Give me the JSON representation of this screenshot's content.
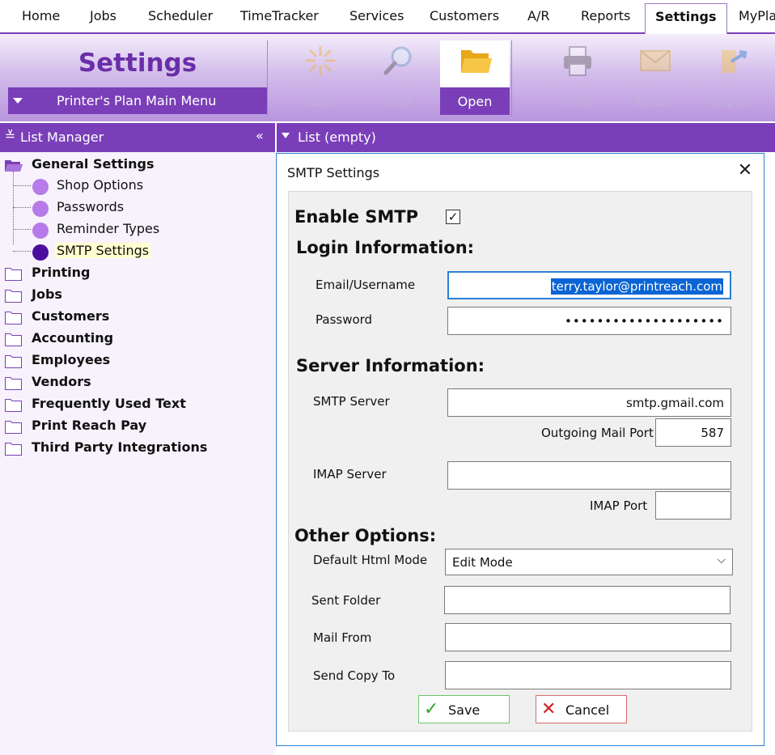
{
  "menu": {
    "tabs": [
      "Home",
      "Jobs",
      "Scheduler",
      "TimeTracker",
      "Services",
      "Customers",
      "A/R",
      "Reports",
      "Settings",
      "MyPla"
    ]
  },
  "ribbon": {
    "title": "Settings",
    "main_menu_label": "Printer's Plan Main Menu",
    "buttons": {
      "new": "New",
      "find": "Find",
      "open": "Open",
      "print": "Print",
      "email": "Email",
      "export": "Export"
    }
  },
  "list_manager": {
    "header": "List Manager",
    "collapse_glyph": "«",
    "tree": {
      "general": "General Settings",
      "children": [
        "Shop Options",
        "Passwords",
        "Reminder Types",
        "SMTP Settings"
      ],
      "others": [
        "Printing",
        "Jobs",
        "Customers",
        "Accounting",
        "Employees",
        "Vendors",
        "Frequently Used Text",
        "Print Reach Pay",
        "Third Party Integrations"
      ]
    }
  },
  "list": {
    "header": "List (empty)"
  },
  "dialog": {
    "title": "SMTP Settings",
    "close_glyph": "✕",
    "enable_smtp_label": "Enable SMTP",
    "enable_smtp_checked": true,
    "check_glyph": "✓",
    "login": {
      "heading": "Login Information:",
      "email_label": "Email/Username",
      "email_value": "terry.taylor@printreach.com",
      "password_label": "Password",
      "password_value": "••••••••••••••••••••"
    },
    "server": {
      "heading": "Server Information:",
      "smtp_label": "SMTP Server",
      "smtp_value": "smtp.gmail.com",
      "out_port_label": "Outgoing Mail Port",
      "out_port_value": "587",
      "imap_label": "IMAP Server",
      "imap_value": "",
      "imap_port_label": "IMAP Port",
      "imap_port_value": ""
    },
    "other": {
      "heading": "Other Options:",
      "html_mode_label": "Default Html Mode",
      "html_mode_value": "Edit Mode",
      "sent_folder_label": "Sent Folder",
      "sent_folder_value": "",
      "mail_from_label": "Mail From",
      "mail_from_value": "",
      "send_copy_label": "Send Copy To",
      "send_copy_value": ""
    },
    "save_label": "Save",
    "cancel_label": "Cancel"
  },
  "colors": {
    "accent": "#7a3fb8",
    "ribbon_title": "#6a2ea8",
    "focus": "#2b80d3",
    "save": "#2ea82e",
    "cancel": "#d42020"
  }
}
